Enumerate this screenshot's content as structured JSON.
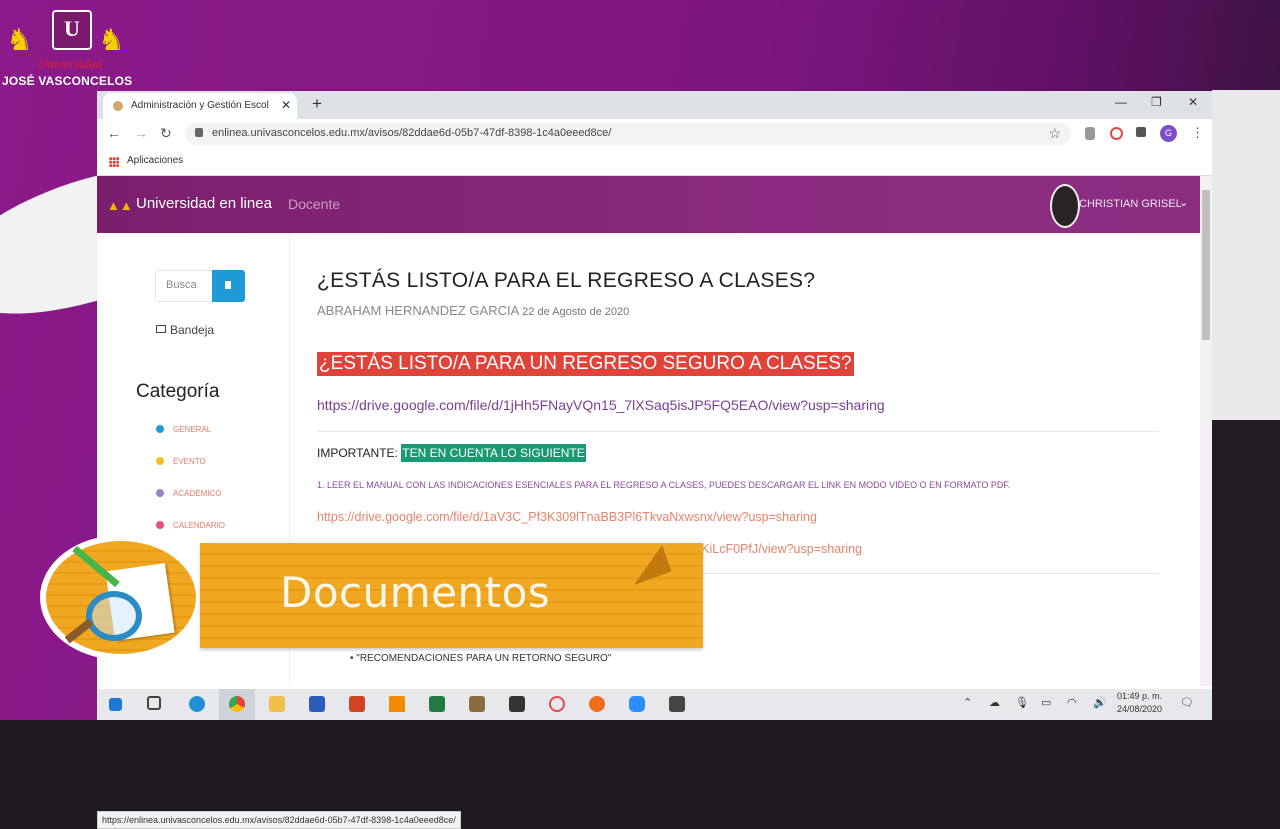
{
  "logo": {
    "initials": "U",
    "line1": "Universidad",
    "line2": "JOSÉ VASCONCELOS"
  },
  "browser": {
    "tab_title": "Administración y Gestión Escolar",
    "url": "enlinea.univasconcelos.edu.mx/avisos/82ddae6d-05b7-47df-8398-1c4a0eeed8ce/",
    "bookmark": "Aplicaciones",
    "status_url": "https://enlinea.univasconcelos.edu.mx/avisos/82ddae6d-05b7-47df-8398-1c4a0eeed8ce/"
  },
  "site": {
    "brand": "Universidad en linea",
    "role": "Docente",
    "user": "CHRISTIAN GRISEL"
  },
  "sidebar": {
    "search_placeholder": "Busca",
    "inbox": "Bandeja",
    "category_title": "Categoría",
    "categories": [
      {
        "label": "GENERAL",
        "color": "#1e9bd7"
      },
      {
        "label": "EVENTO",
        "color": "#f2c11b"
      },
      {
        "label": "ACADEMICO",
        "color": "#9a7fc9"
      },
      {
        "label": "CALENDARIO",
        "color": "#e6527a"
      }
    ]
  },
  "post": {
    "title": "¿ESTÁS LISTO/A PARA EL REGRESO A CLASES?",
    "author": "ABRAHAM HERNANDEZ GARCIA",
    "date": "22 de Agosto de 2020",
    "highlight": "¿ESTÁS LISTO/A PARA UN REGRESO SEGURO A CLASES?",
    "link1": "https://drive.google.com/file/d/1jHh5FNayVQn15_7lXSaq5isJP5FQ5EAO/view?usp=sharing",
    "important_label": "IMPORTANTE:",
    "important_tag": "TEN EN CUENTA LO SIGUIENTE",
    "note": "1. LEER EL MANUAL CON LAS INDICACIONES ESENCIALES PARA EL REGRESO A CLASES, PUEDES DESCARGAR EL LINK EN MODO VIDEO O EN FORMATO PDF.",
    "link2": "https://drive.google.com/file/d/1aV3C_Pf3K309lTnaBB3Pl6TkvaNxwsnx/view?usp=sharing",
    "link3": "OhgggYKhKiLcF0PfJ/view?usp=sharing",
    "bullet": "\"RECOMENDACIONES PARA UN RETORNO SEGURO\""
  },
  "overlay": {
    "word": "Documentos"
  },
  "taskbar": {
    "time": "01:49 p. m.",
    "date": "24/08/2020"
  }
}
